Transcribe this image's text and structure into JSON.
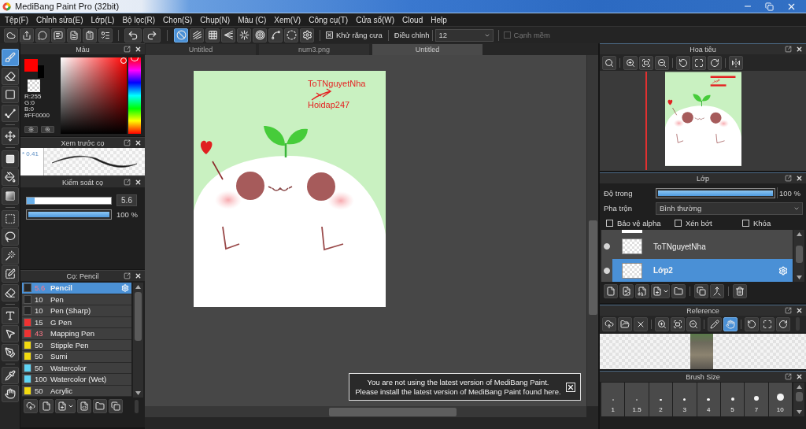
{
  "window": {
    "title": "MediBang Paint Pro (32bit)"
  },
  "menu": [
    "Tệp(F)",
    "Chỉnh sửa(E)",
    "Lớp(L)",
    "Bộ lọc(R)",
    "Chọn(S)",
    "Chụp(N)",
    "Màu (C)",
    "Xem(V)",
    "Công cụ(T)",
    "Cửa sổ(W)",
    "Cloud",
    "Help"
  ],
  "toolbar": {
    "snap_modes": [
      {
        "kind": "off",
        "selected": true
      },
      {
        "kind": "parallel",
        "selected": false
      },
      {
        "kind": "grid",
        "selected": false
      },
      {
        "kind": "perspective",
        "selected": false
      },
      {
        "kind": "radial",
        "selected": false
      },
      {
        "kind": "concentric",
        "selected": false
      },
      {
        "kind": "curve",
        "selected": false
      },
      {
        "kind": "circle",
        "selected": false
      },
      {
        "kind": "settings",
        "selected": false
      }
    ],
    "antialias": {
      "label": "Khử răng cưa",
      "checked": true
    },
    "correction": {
      "label": "Điều chỉnh",
      "value": "12"
    },
    "soft_edge": {
      "label": "Cạnh mềm",
      "checked": false,
      "disabled": true
    }
  },
  "tools": [
    {
      "kind": "brush",
      "selected": true
    },
    {
      "kind": "eraser",
      "selected": false
    },
    {
      "kind": "dot",
      "selected": false
    },
    {
      "kind": "line",
      "selected": false
    },
    {
      "kind": "move",
      "selected": false
    },
    {
      "kind": "fill",
      "selected": false
    },
    {
      "kind": "bucket",
      "selected": false
    },
    {
      "kind": "gradient",
      "selected": false
    },
    {
      "kind": "select",
      "selected": false
    },
    {
      "kind": "lasso",
      "selected": false
    },
    {
      "kind": "wand",
      "selected": false
    },
    {
      "kind": "selectpen",
      "selected": false
    },
    {
      "kind": "selecteraser",
      "selected": false
    },
    {
      "kind": "text",
      "selected": false
    },
    {
      "kind": "operation",
      "selected": false
    },
    {
      "kind": "nib",
      "selected": false
    },
    {
      "kind": "dropper",
      "selected": false
    },
    {
      "kind": "hand",
      "selected": false
    }
  ],
  "color_panel": {
    "title": "Màu",
    "swatches": [
      {
        "kind": "main",
        "color": "#ff0000"
      },
      {
        "kind": "sub",
        "color": "#000000"
      }
    ],
    "readout": [
      "R:255",
      "G:0",
      "B:0",
      "#FF0000"
    ],
    "hue": {
      "level": 0
    }
  },
  "brush_preview": {
    "title": "Xem trước cọ",
    "size": "* 0.41"
  },
  "brush_control": {
    "title": "Kiểm soát cọ",
    "size": {
      "level": 0.09,
      "value": "5.6"
    },
    "opacity": {
      "level": 1,
      "value": "100 %"
    }
  },
  "brush_list": {
    "title": "Cọ: Pencil",
    "brushes": [
      {
        "color": "#262626",
        "size": "5.6",
        "name": "Pencil",
        "modified": true,
        "selected": true
      },
      {
        "color": "#262626",
        "size": "10",
        "name": "Pen",
        "modified": false,
        "selected": false
      },
      {
        "color": "#262626",
        "size": "10",
        "name": "Pen (Sharp)",
        "modified": false,
        "selected": false
      },
      {
        "color": "#ee3333",
        "size": "15",
        "name": "G Pen",
        "modified": false,
        "selected": false
      },
      {
        "color": "#ee3333",
        "size": "43",
        "name": "Mapping Pen",
        "modified": true,
        "selected": false
      },
      {
        "color": "#f2da10",
        "size": "50",
        "name": "Stipple Pen",
        "modified": false,
        "selected": false
      },
      {
        "color": "#f2da10",
        "size": "50",
        "name": "Sumi",
        "modified": false,
        "selected": false
      },
      {
        "color": "#5fd4f4",
        "size": "50",
        "name": "Watercolor",
        "modified": false,
        "selected": false
      },
      {
        "color": "#5fd4f4",
        "size": "100",
        "name": "Watercolor (Wet)",
        "modified": false,
        "selected": false
      },
      {
        "color": "#f2da10",
        "size": "50",
        "name": "Acrylic",
        "modified": false,
        "selected": false
      }
    ]
  },
  "tabs": [
    {
      "label": "Untitled",
      "selected": false
    },
    {
      "label": "num3.png",
      "selected": false
    },
    {
      "label": "Untitled",
      "selected": true
    }
  ],
  "canvas": {
    "signature": [
      "ToTNguyetNha",
      "Hoidap247"
    ]
  },
  "notice": {
    "lines": [
      "You are not using the latest version of MediBang Paint.",
      "Please install the latest version of MediBang Paint found here."
    ]
  },
  "navigator": {
    "title": "Hoa tiêu"
  },
  "layers": {
    "title": "Lớp",
    "opacity": {
      "label": "Độ trong",
      "level": 1,
      "value": "100 %"
    },
    "blend": {
      "label": "Pha trộn",
      "value": "Bình thường"
    },
    "options": [
      {
        "label": "Bảo vệ alpha",
        "checked": false
      },
      {
        "label": "Xén bớt",
        "checked": false
      },
      {
        "label": "Khóa",
        "checked": false
      }
    ],
    "items": [
      {
        "name": "ToTNguyetNha",
        "visible": true,
        "selected": false
      },
      {
        "name": "Lớp2",
        "visible": true,
        "selected": true
      }
    ]
  },
  "reference": {
    "title": "Reference",
    "modes": [
      {
        "kind": "pen",
        "selected": false
      },
      {
        "kind": "hand",
        "selected": true
      }
    ]
  },
  "brush_size": {
    "title": "Brush Size",
    "sizes": [
      "1",
      "1.5",
      "2",
      "3",
      "4",
      "5",
      "7",
      "10"
    ]
  }
}
